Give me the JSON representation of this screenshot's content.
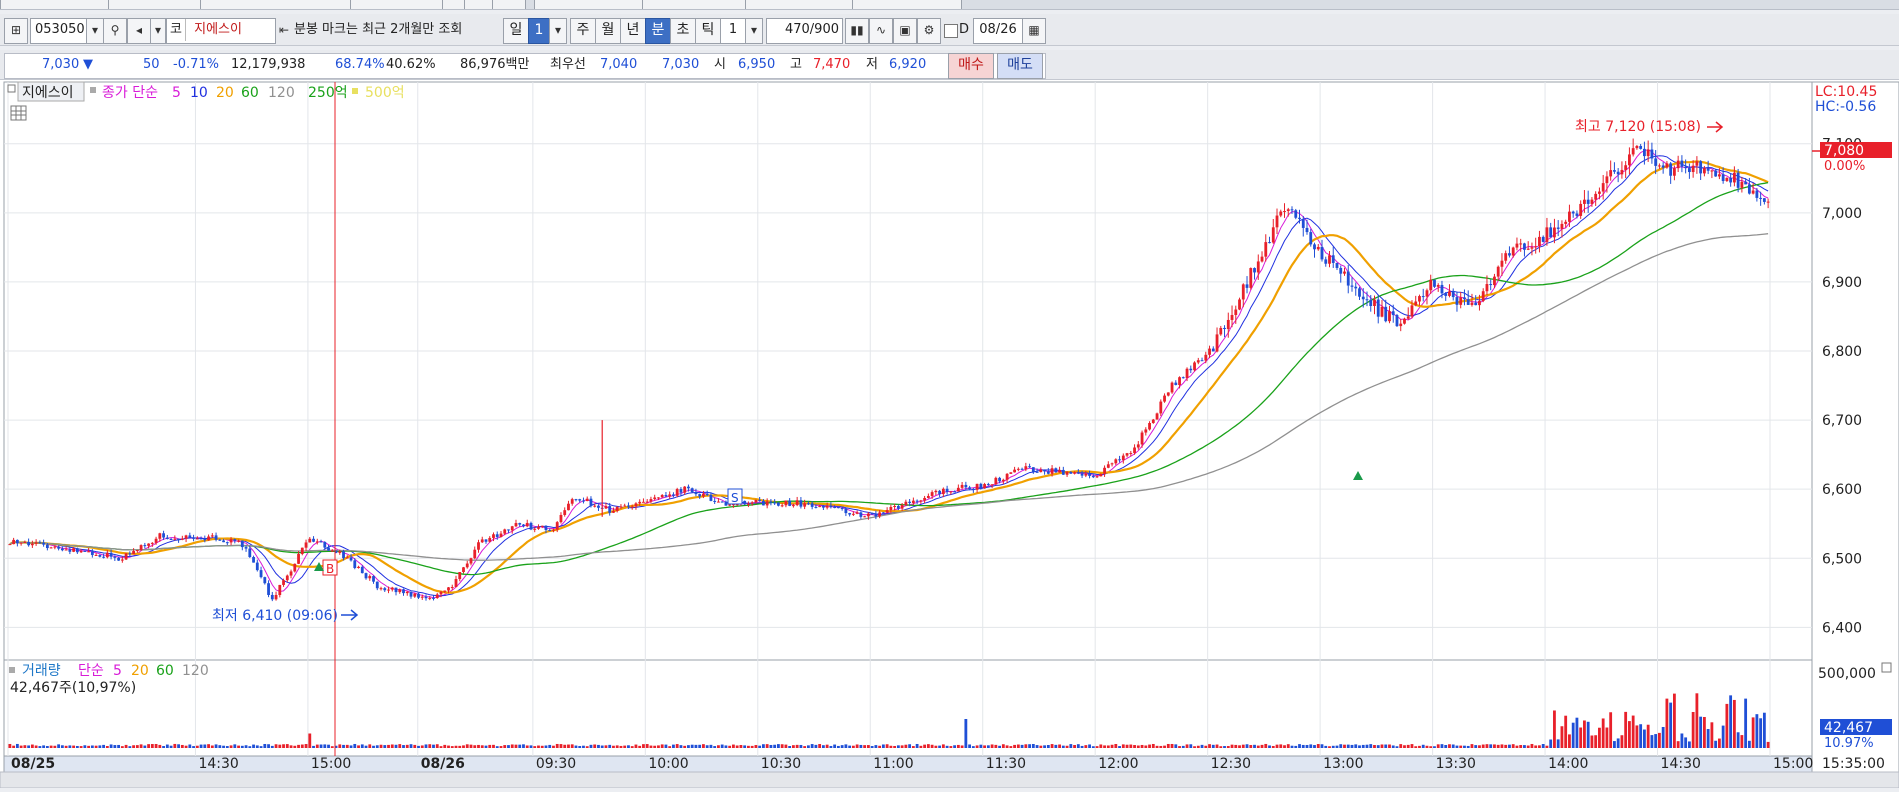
{
  "toolbar": {
    "code": "053050",
    "market_mark": "코",
    "stock_name": "지에스이",
    "notice": "분봉 마크는 최근 2개월만 조회",
    "period_tabs": [
      "일",
      "1",
      "주",
      "월",
      "년",
      "분",
      "초",
      "틱"
    ],
    "interval": "1",
    "count": "470/900",
    "d_label": "D",
    "date": "08/26"
  },
  "quote": {
    "price": "7,030",
    "arrow": "▼",
    "change": "50",
    "change_pct": "-0.71%",
    "volume": "12,179,938",
    "vol_ratio": "68.74%",
    "turnover": "40.62%",
    "amount": "86,976백만",
    "best_label": "최우선",
    "best_ask": "7,040",
    "best_bid": "7,030",
    "open_label": "시",
    "open": "6,950",
    "high_label": "고",
    "high": "7,470",
    "low_label": "저",
    "low": "6,920",
    "buy_label": "매수",
    "sell_label": "매도"
  },
  "legend": {
    "name": "지에스이",
    "series_label": "종가 단순",
    "ma": [
      "5",
      "10",
      "20",
      "60",
      "120",
      "250억",
      "500억"
    ],
    "vol_name": "거래량",
    "vol_series_label": "단순",
    "vol_ma": [
      "5",
      "20",
      "60",
      "120"
    ],
    "vol_value": "42,467주(10,97%)"
  },
  "colors": {
    "up": "#e8202a",
    "down": "#1f4fd6",
    "ma5": "#d81bd8",
    "ma10": "#2030e0",
    "ma20": "#f0a000",
    "ma60": "#1aa21a",
    "ma120": "#909090",
    "hline": "#e8202a"
  },
  "right_axis": {
    "lc": "LC:10.45",
    "hc": "HC:-0.56",
    "current": "7,080",
    "current_pct": "0.00%",
    "vol_current": "42,467",
    "vol_pct": "10.97%"
  },
  "annotations": {
    "max": "최고 7,120 (15:08)",
    "min": "최저 6,410 (09:06)",
    "buy": "B",
    "sell": "S"
  },
  "footer": {
    "time": "15:35:00"
  },
  "chart_data": {
    "type": "candlestick",
    "title": "",
    "y_ticks": [
      "7,100",
      "7,000",
      "6,900",
      "6,800",
      "6,700",
      "6,600",
      "6,500",
      "6,400"
    ],
    "ylim": [
      6360,
      7185
    ],
    "x_ticks": [
      "08/25",
      "14:30",
      "15:00",
      "08/26",
      "09:30",
      "10:00",
      "10:30",
      "11:00",
      "11:30",
      "12:00",
      "12:30",
      "13:00",
      "13:30",
      "14:00",
      "14:30",
      "15:00"
    ],
    "vol_tick": "500,000",
    "anchors": {
      "t": [
        0,
        20,
        30,
        40,
        48,
        55,
        62,
        70,
        80,
        90,
        98,
        105,
        112,
        118,
        125,
        135,
        145,
        150,
        160,
        170,
        180,
        190,
        200,
        210,
        220,
        230,
        240,
        250,
        260,
        270,
        280,
        290,
        300,
        310,
        320,
        330,
        340,
        350,
        360,
        370,
        380,
        390,
        400,
        410,
        420,
        428,
        435,
        440,
        447,
        453,
        460,
        466
      ],
      "close": [
        6525,
        6510,
        6500,
        6532,
        6530,
        6530,
        6520,
        6440,
        6530,
        6500,
        6460,
        6450,
        6440,
        6460,
        6520,
        6550,
        6540,
        6590,
        6570,
        6580,
        6600,
        6580,
        6580,
        6580,
        6570,
        6560,
        6580,
        6600,
        6605,
        6630,
        6625,
        6620,
        6660,
        6750,
        6800,
        6900,
        7010,
        6940,
        6880,
        6840,
        6900,
        6860,
        6940,
        6970,
        7010,
        7060,
        7100,
        7060,
        7070,
        7060,
        7050,
        7020
      ]
    },
    "highlights": [
      {
        "t": 158,
        "high": 6700,
        "low": 6560
      },
      {
        "t": 370,
        "high": 6810,
        "low": 6810
      }
    ]
  }
}
